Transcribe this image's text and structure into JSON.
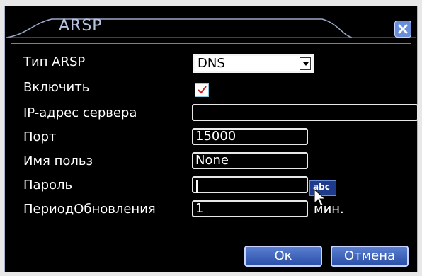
{
  "dialog": {
    "title": "ARSP",
    "close_icon": "close-x-icon"
  },
  "fields": {
    "arsp_type": {
      "label": "Тип ARSP",
      "value": "DNS"
    },
    "enable": {
      "label": "Включить",
      "checked": true
    },
    "server_ip": {
      "label": "IP-адрес сервера",
      "value": ""
    },
    "port": {
      "label": "Порт",
      "value": "15000"
    },
    "username": {
      "label": "Имя польз",
      "value": "None"
    },
    "password": {
      "label": "Пароль",
      "value": ""
    },
    "update_period": {
      "label": "ПериодОбновления",
      "value": "1",
      "unit": "мин."
    }
  },
  "keyboard_button": {
    "label": "abc"
  },
  "buttons": {
    "ok": "Ок",
    "cancel": "Отмена"
  },
  "colors": {
    "background": "#000000",
    "accent": "#2a4fa8",
    "border": "#7080a8"
  }
}
